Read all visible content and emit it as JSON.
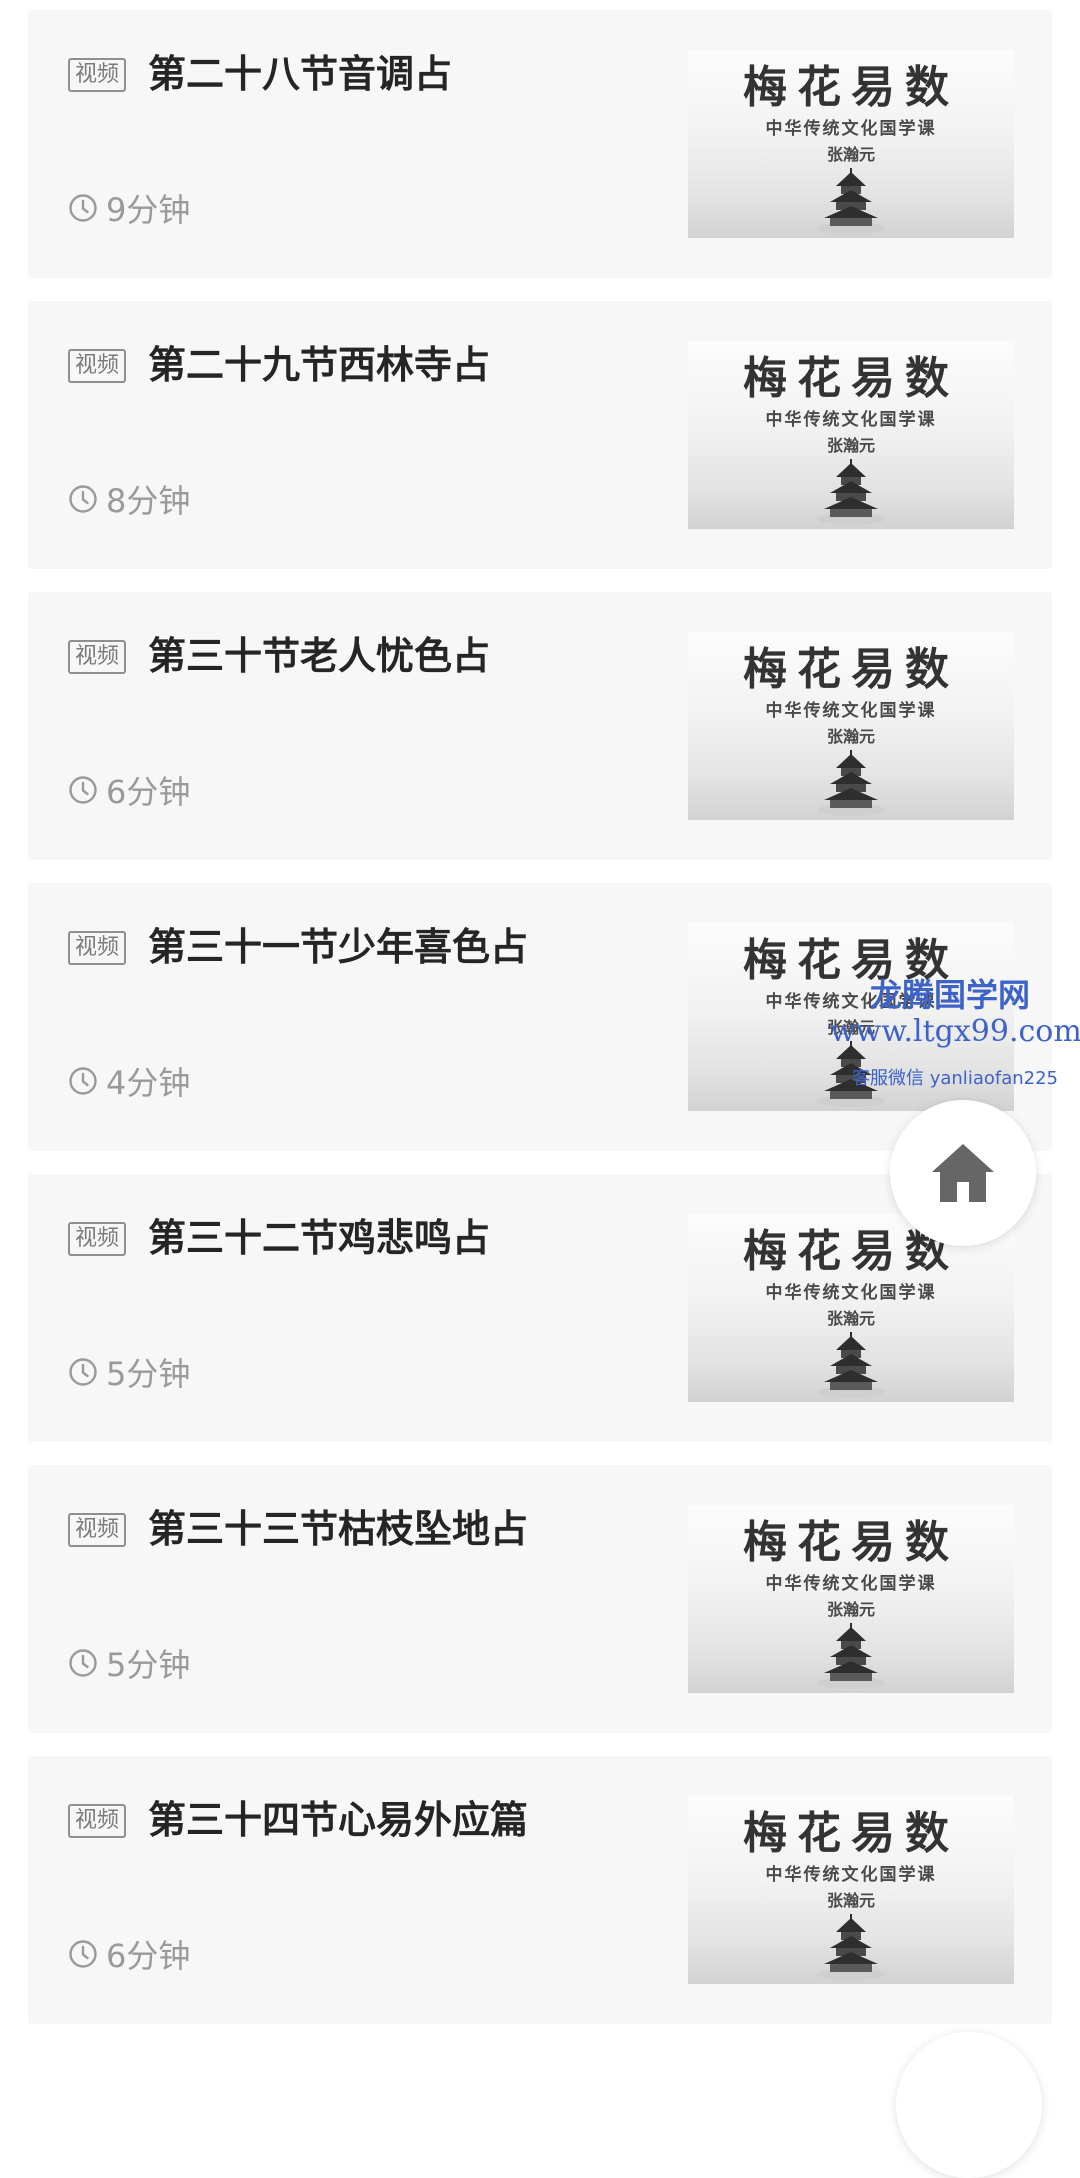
{
  "lessons": [
    {
      "tag": "视频",
      "title": "第二十八节音调占",
      "duration": "9分钟"
    },
    {
      "tag": "视频",
      "title": "第二十九节西林寺占",
      "duration": "8分钟"
    },
    {
      "tag": "视频",
      "title": "第三十节老人忧色占",
      "duration": "6分钟"
    },
    {
      "tag": "视频",
      "title": "第三十一节少年喜色占",
      "duration": "4分钟"
    },
    {
      "tag": "视频",
      "title": "第三十二节鸡悲鸣占",
      "duration": "5分钟"
    },
    {
      "tag": "视频",
      "title": "第三十三节枯枝坠地占",
      "duration": "5分钟"
    },
    {
      "tag": "视频",
      "title": "第三十四节心易外应篇",
      "duration": "6分钟"
    }
  ],
  "thumbnail": {
    "title": "梅花易数",
    "subtitle": "中华传统文化国学课",
    "author": "张瀚元",
    "image": "temple-of-heaven-ink-painting"
  },
  "watermark": {
    "name": "龙腾国学网",
    "url": "www.ltgx99.com",
    "contact": "客服微信 yanliaofan225"
  },
  "icons": {
    "duration": "clock-icon",
    "floating_button": "home-icon"
  },
  "colors": {
    "card_background": "#f7f7f8",
    "title_text": "#252525",
    "meta_text": "#9a9a9a",
    "watermark": "#3d63c9",
    "home_icon": "#666666"
  }
}
